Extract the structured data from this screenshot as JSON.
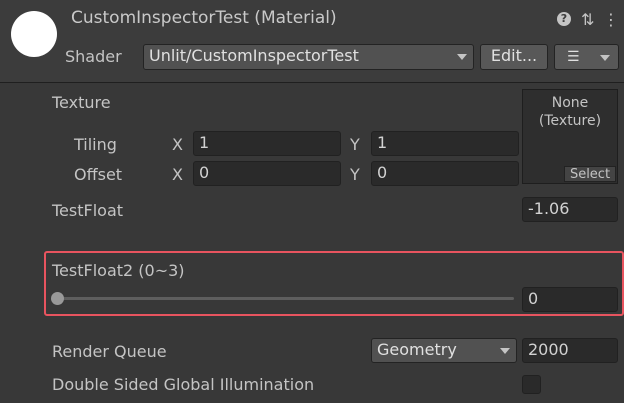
{
  "header": {
    "title": "CustomInspectorTest (Material)",
    "help_glyph": "?",
    "settings_glyph": "⇅",
    "menu_glyph": "⋮",
    "shader_label": "Shader",
    "shader_value": "Unlit/CustomInspectorTest",
    "edit_button": "Edit...",
    "list_glyph": "☰"
  },
  "texture": {
    "label": "Texture",
    "tiling_label": "Tiling",
    "offset_label": "Offset",
    "x_label": "X",
    "y_label": "Y",
    "tiling_x": "1",
    "tiling_y": "1",
    "offset_x": "0",
    "offset_y": "0",
    "slot_text_line1": "None",
    "slot_text_line2": "(Texture)",
    "select_button": "Select"
  },
  "test_float": {
    "label": "TestFloat",
    "value": "-1.06"
  },
  "test_float2": {
    "label": "TestFloat2 (0~3)",
    "value": "0",
    "slider_level": 0
  },
  "render_queue": {
    "label": "Render Queue",
    "dropdown_value": "Geometry",
    "value": "2000"
  },
  "double_sided_gi": {
    "label": "Double Sided Global Illumination",
    "checked": false
  },
  "colors": {
    "highlight": "#e8545f",
    "background": "#383838"
  }
}
